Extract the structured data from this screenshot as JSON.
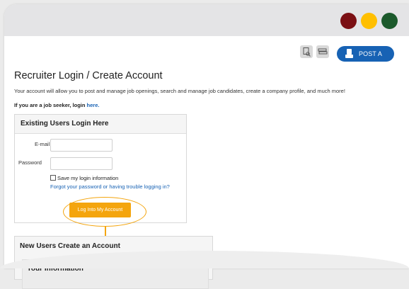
{
  "window": {
    "dot_colors": [
      "#7b1014",
      "#ffbf00",
      "#1c5a2c"
    ]
  },
  "toolbar": {
    "icons": [
      "document-search-icon",
      "money-stack-icon",
      "briefcase-icon"
    ],
    "post_job_label": "POST A JOB",
    "accent_color": "#1762b4"
  },
  "page": {
    "title": "Recruiter Login / Create Account",
    "description": "Your account will allow you to post and manage job openings, search and manage job candidates, create a company profile, and much more!",
    "seeker_text": "If you are a job seeker, login ",
    "seeker_link": "here."
  },
  "login": {
    "header": "Existing Users Login Here",
    "email_label": "E-mail",
    "email_value": "",
    "password_label": "Password",
    "password_value": "",
    "save_label": "Save my login information",
    "forgot_link": "Forgot your password or having trouble logging in?",
    "button_label": "Log Into My Account",
    "button_color": "#f4a50e"
  },
  "create": {
    "header": "New Users Create an Account",
    "sub_header": "Your Information"
  }
}
